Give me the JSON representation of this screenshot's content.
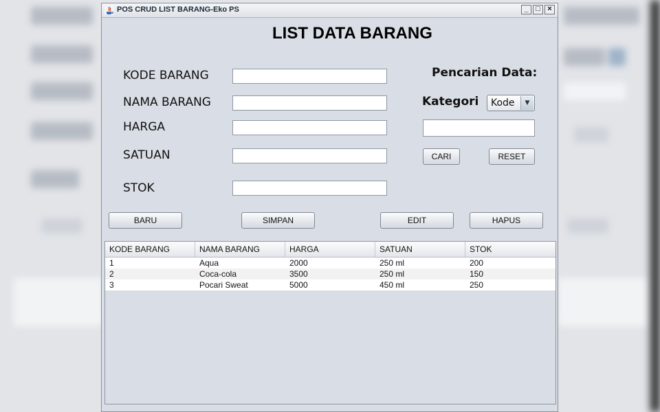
{
  "window": {
    "title": "POS CRUD LIST BARANG-Eko PS"
  },
  "heading": "LIST DATA BARANG",
  "form": {
    "kode_label": "KODE BARANG",
    "nama_label": "NAMA BARANG",
    "harga_label": "HARGA",
    "satuan_label": "SATUAN",
    "stok_label": "STOK"
  },
  "search": {
    "title": "Pencarian Data:",
    "kategori_label": "Kategori",
    "kategori_value": "Kode",
    "cari_label": "CARI",
    "reset_label": "RESET"
  },
  "actions": {
    "baru_label": "BARU",
    "simpan_label": "SIMPAN",
    "edit_label": "EDIT",
    "hapus_label": "HAPUS"
  },
  "table": {
    "columns": [
      "KODE BARANG",
      "NAMA BARANG",
      "HARGA",
      "SATUAN",
      "STOK"
    ],
    "rows": [
      [
        "1",
        "Aqua",
        "2000",
        "250 ml",
        "200"
      ],
      [
        "2",
        "Coca-cola",
        "3500",
        "250 ml",
        "150"
      ],
      [
        "3",
        "Pocari Sweat",
        "5000",
        "450 ml",
        "250"
      ]
    ]
  }
}
